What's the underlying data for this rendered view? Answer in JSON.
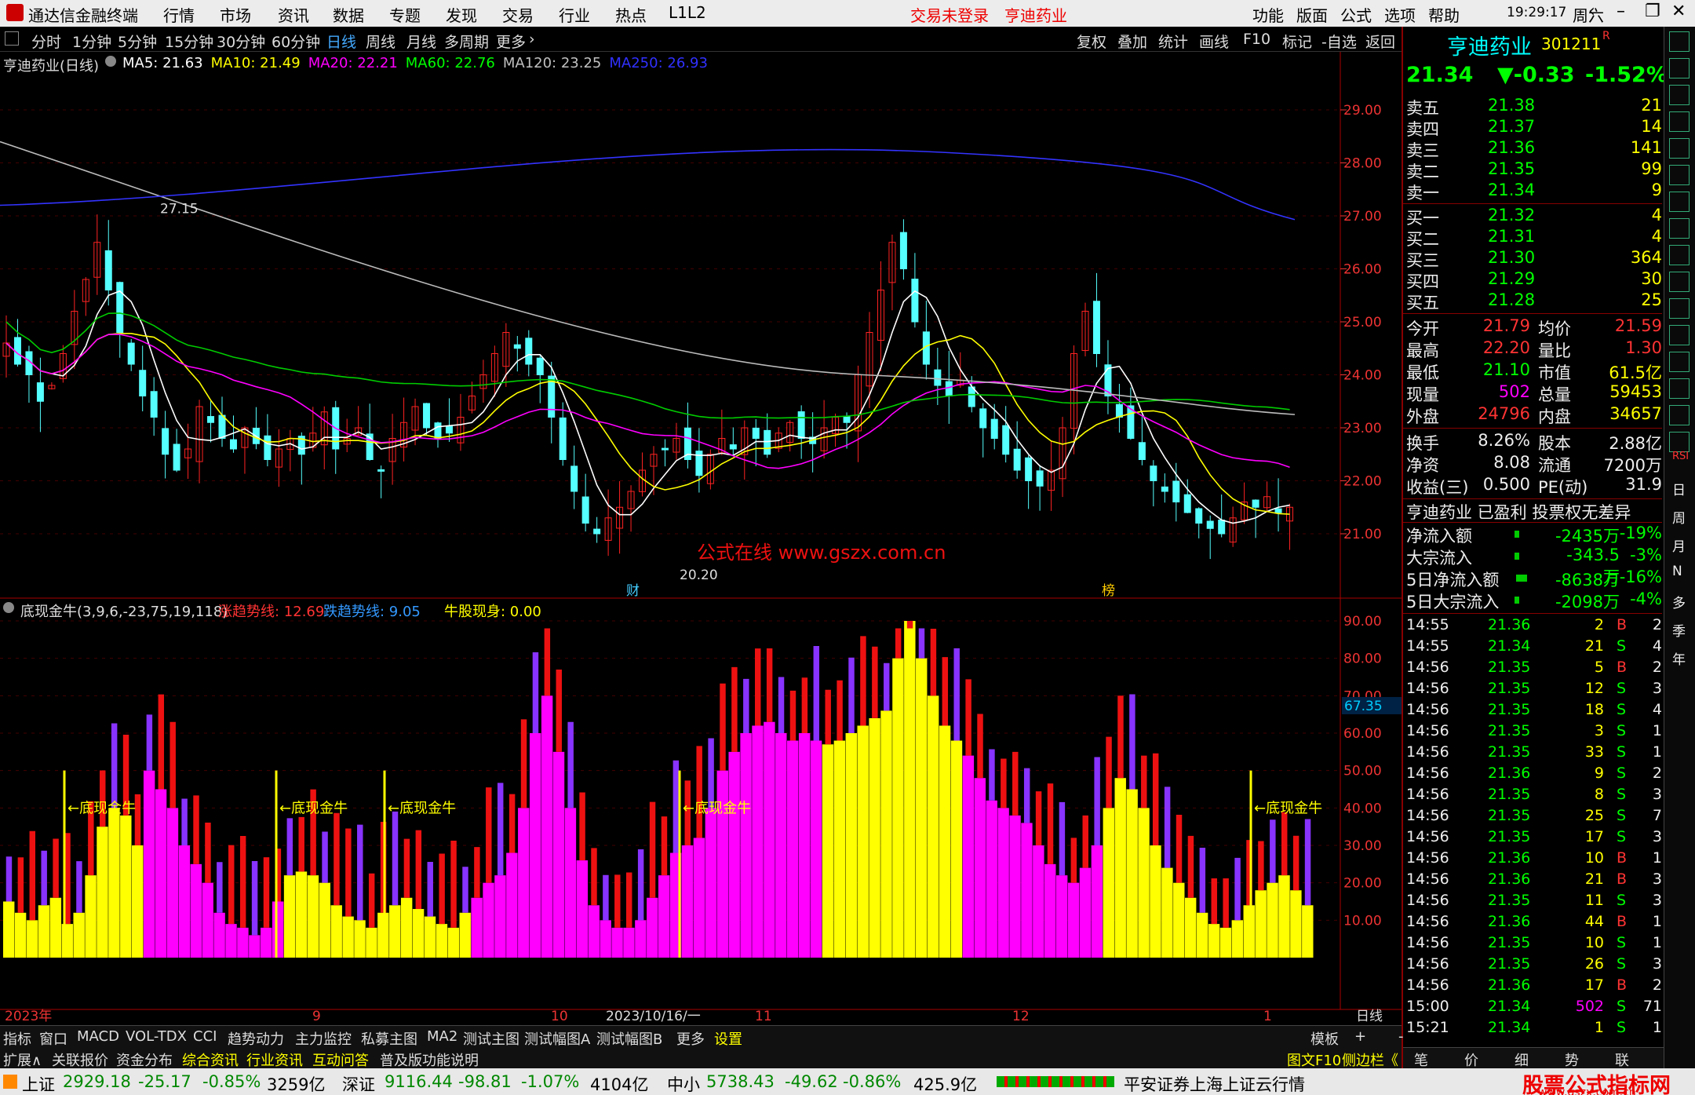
{
  "app": {
    "title": "通达信金融终端",
    "menu": [
      "行情",
      "市场",
      "资讯",
      "数据",
      "专题",
      "发现",
      "交易",
      "行业",
      "热点",
      "L1L2"
    ],
    "trade_status": "交易未登录",
    "stock_short": "亨迪药业",
    "right_menu": [
      "功能",
      "版面",
      "公式",
      "选项",
      "帮助"
    ],
    "clock": "19:29:17",
    "weekday": "周六"
  },
  "periods": [
    "分时",
    "1分钟",
    "5分钟",
    "15分钟",
    "30分钟",
    "60分钟",
    "日线",
    "周线",
    "月线",
    "多周期",
    "更多"
  ],
  "tools": [
    "复权",
    "叠加",
    "统计",
    "画线",
    "F10",
    "标记",
    "-自选",
    "返回"
  ],
  "main_chart": {
    "title": "亨迪药业(日线)",
    "ma": [
      {
        "label": "MA5: 21.63",
        "color": "#ffffff"
      },
      {
        "label": "MA10: 21.49",
        "color": "#ffff00"
      },
      {
        "label": "MA20: 22.21",
        "color": "#ff00ff"
      },
      {
        "label": "MA60: 22.76",
        "color": "#00ff00"
      },
      {
        "label": "MA120: 23.25",
        "color": "#c0c0c0"
      },
      {
        "label": "MA250: 26.93",
        "color": "#3030ff"
      }
    ],
    "y_ticks": [
      "29.00",
      "28.00",
      "27.00",
      "26.00",
      "25.00",
      "24.00",
      "23.00",
      "22.00",
      "21.00"
    ],
    "high_label": "27.15",
    "low_label": "20.20",
    "watermark": "公式在线  www.gszx.com.cn",
    "marker_cai": "财",
    "marker_bang": "榜"
  },
  "indicator": {
    "title": "底现金牛(3,9,6,-23,75,19,118)",
    "up": "涨趋势线: 12.69",
    "down": "跌趋势线: 9.05",
    "bull": "牛股现身: 0.00",
    "y_ticks": [
      "90.00",
      "80.00",
      "70.00",
      "60.00",
      "50.00",
      "40.00",
      "30.00",
      "20.00",
      "10.00"
    ],
    "current": "67.35",
    "signal": "←底现金牛"
  },
  "x_axis": {
    "labels": [
      "2023年",
      "9",
      "10",
      "2023/10/16/一",
      "11",
      "12",
      "1"
    ],
    "period": "日线"
  },
  "quote": {
    "name": "亨迪药业",
    "code": "301211",
    "flag": "R",
    "price": "21.34",
    "change": "▼-0.33",
    "pct": "-1.52%",
    "asks": [
      [
        "卖五",
        "21.38",
        "21"
      ],
      [
        "卖四",
        "21.37",
        "14"
      ],
      [
        "卖三",
        "21.36",
        "141"
      ],
      [
        "卖二",
        "21.35",
        "99"
      ],
      [
        "卖一",
        "21.34",
        "9"
      ]
    ],
    "bids": [
      [
        "买一",
        "21.32",
        "4"
      ],
      [
        "买二",
        "21.31",
        "4"
      ],
      [
        "买三",
        "21.30",
        "364"
      ],
      [
        "买四",
        "21.29",
        "30"
      ],
      [
        "买五",
        "21.28",
        "25"
      ]
    ],
    "stats": [
      [
        "今开",
        "21.79",
        "均价",
        "21.59"
      ],
      [
        "最高",
        "22.20",
        "量比",
        "1.30"
      ],
      [
        "最低",
        "21.10",
        "市值",
        "61.5亿"
      ],
      [
        "现量",
        "502",
        "总量",
        "59453"
      ],
      [
        "外盘",
        "24796",
        "内盘",
        "34657"
      ]
    ],
    "stats2": [
      [
        "换手",
        "8.26%",
        "股本",
        "2.88亿"
      ],
      [
        "净资",
        "8.08",
        "流通",
        "7200万"
      ],
      [
        "收益(三)",
        "0.500",
        "PE(动)",
        "31.9"
      ]
    ],
    "tagline": "亨迪药业 已盈利 投票权无差异",
    "flows": [
      [
        "净流入额",
        "-2435万",
        "-19%"
      ],
      [
        "大宗流入",
        "-343.5万",
        "-3%"
      ],
      [
        "5日净流入额",
        "-8638万",
        "-16%"
      ],
      [
        "5日大宗流入",
        "-2098万",
        "-4%"
      ]
    ],
    "ticks": [
      [
        "14:55",
        "21.36",
        "2",
        "B",
        "2"
      ],
      [
        "14:55",
        "21.34",
        "21",
        "S",
        "4"
      ],
      [
        "14:56",
        "21.35",
        "5",
        "B",
        "2"
      ],
      [
        "14:56",
        "21.35",
        "12",
        "S",
        "3"
      ],
      [
        "14:56",
        "21.35",
        "18",
        "S",
        "4"
      ],
      [
        "14:56",
        "21.35",
        "3",
        "S",
        "1"
      ],
      [
        "14:56",
        "21.35",
        "33",
        "S",
        "1"
      ],
      [
        "14:56",
        "21.36",
        "9",
        "S",
        "2"
      ],
      [
        "14:56",
        "21.35",
        "8",
        "S",
        "3"
      ],
      [
        "14:56",
        "21.35",
        "25",
        "S",
        "7"
      ],
      [
        "14:56",
        "21.35",
        "17",
        "S",
        "3"
      ],
      [
        "14:56",
        "21.36",
        "10",
        "B",
        "1"
      ],
      [
        "14:56",
        "21.36",
        "21",
        "B",
        "3"
      ],
      [
        "14:56",
        "21.35",
        "11",
        "S",
        "3"
      ],
      [
        "14:56",
        "21.36",
        "44",
        "B",
        "1"
      ],
      [
        "14:56",
        "21.35",
        "10",
        "S",
        "1"
      ],
      [
        "14:56",
        "21.35",
        "26",
        "S",
        "3"
      ],
      [
        "14:56",
        "21.36",
        "17",
        "B",
        "2"
      ],
      [
        "15:00",
        "21.34",
        "502",
        "S",
        "71"
      ],
      [
        "15:21",
        "21.34",
        "1",
        "S",
        "1"
      ]
    ],
    "bottom_tabs": [
      "笔",
      "价",
      "细",
      "势",
      "联"
    ]
  },
  "bottom_tabs1": [
    "指标",
    "窗口",
    "MACD",
    "VOL-TDX",
    "CCI",
    "趋势动力",
    "主力监控",
    "私募主图",
    "MA2",
    "测试主图",
    "测试幅图A",
    "测试幅图B",
    "更多",
    "设置"
  ],
  "bottom_right1": [
    "模板",
    "+",
    "-"
  ],
  "bottom_tabs2": [
    "扩展∧",
    "关联报价",
    "资金分布",
    "综合资讯",
    "行业资讯",
    "互动问答",
    "普及版功能说明"
  ],
  "bottom_right2": [
    "图文F10",
    "侧边栏《"
  ],
  "sidebar_icons": [
    "RSI",
    "日",
    "周",
    "月",
    "N",
    "多",
    "季",
    "年"
  ],
  "status": {
    "sh_label": "上证",
    "sh": "2929.18",
    "sh_chg": "-25.17",
    "sh_pct": "-0.85%",
    "sh_amt": "3259亿",
    "sz_label": "深证",
    "sz": "9116.44",
    "sz_chg": "-98.81",
    "sz_pct": "-1.07%",
    "sz_amt": "4104亿",
    "zx_label": "中小",
    "zx": "5738.43",
    "zx_chg": "-49.62",
    "zx_pct": "-0.86%",
    "zx_amt": "425.9亿",
    "broker": "平安证券上海上证云行情",
    "brand": "股票公式指标网",
    "brand_url": "www.gszx.com.cn"
  }
}
